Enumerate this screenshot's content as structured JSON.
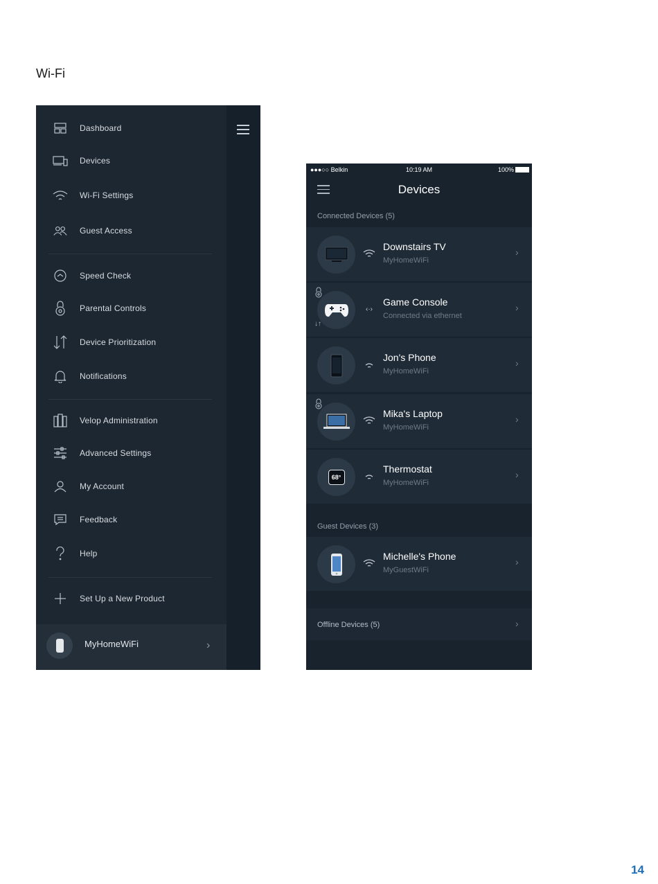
{
  "page": {
    "heading": "Wi-Fi",
    "page_number": "14"
  },
  "menu": {
    "items": [
      {
        "label": "Dashboard",
        "icon": "dashboard-icon"
      },
      {
        "label": "Devices",
        "icon": "devices-icon"
      },
      {
        "label": "Wi-Fi Settings",
        "icon": "wifi-icon"
      },
      {
        "label": "Guest Access",
        "icon": "guest-access-icon"
      },
      {
        "label": "Speed Check",
        "icon": "speed-check-icon"
      },
      {
        "label": "Parental Controls",
        "icon": "lock-icon"
      },
      {
        "label": "Device Prioritization",
        "icon": "prioritization-icon"
      },
      {
        "label": "Notifications",
        "icon": "bell-icon"
      },
      {
        "label": "Velop Administration",
        "icon": "velop-admin-icon"
      },
      {
        "label": "Advanced Settings",
        "icon": "sliders-icon"
      },
      {
        "label": "My Account",
        "icon": "account-icon"
      },
      {
        "label": "Feedback",
        "icon": "feedback-icon"
      },
      {
        "label": "Help",
        "icon": "help-icon"
      },
      {
        "label": "Set Up a New Product",
        "icon": "plus-icon"
      }
    ],
    "footer": {
      "network_name": "MyHomeWiFi"
    }
  },
  "devices_screen": {
    "status_bar": {
      "carrier": "●●●○○ Belkin",
      "time": "10:19 AM",
      "battery": "100%"
    },
    "title": "Devices",
    "connected_label": "Connected Devices (5)",
    "connected": [
      {
        "name": "Downstairs TV",
        "sub": "MyHomeWiFi",
        "icon": "tv-icon",
        "connection": "wifi-icon"
      },
      {
        "name": "Game Console",
        "sub": "Connected via ethernet",
        "icon": "gamepad-icon",
        "connection": "ethernet-icon"
      },
      {
        "name": "Jon's Phone",
        "sub": "MyHomeWiFi",
        "icon": "phone-icon",
        "connection": "wifi-icon"
      },
      {
        "name": "Mika's Laptop",
        "sub": "MyHomeWiFi",
        "icon": "laptop-icon",
        "connection": "wifi-icon"
      },
      {
        "name": "Thermostat",
        "sub": "MyHomeWiFi",
        "icon": "thermostat-icon",
        "connection": "wifi-icon",
        "display": "68°"
      }
    ],
    "guest_label": "Guest Devices  (3)",
    "guest": [
      {
        "name": "Michelle's Phone",
        "sub": "MyGuestWiFi",
        "icon": "phone-icon",
        "connection": "wifi-icon"
      }
    ],
    "offline_label": "Offline Devices  (5)",
    "chevron": "›"
  }
}
